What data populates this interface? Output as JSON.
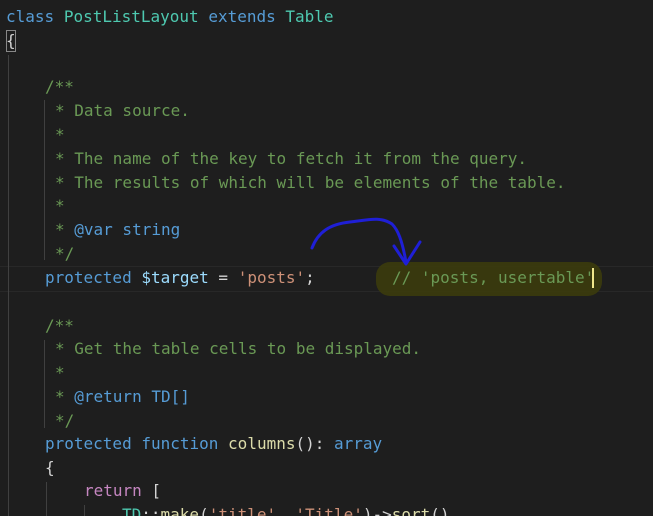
{
  "code": {
    "line1": {
      "kw_class": "class",
      "class_name": "PostListLayout",
      "kw_extends": "extends",
      "parent": "Table"
    },
    "line2": {
      "brace": "{"
    },
    "doc1": {
      "open": "/**",
      "l1": "* Data source.",
      "l2": "*",
      "l3": "* The name of the key to fetch it from the query.",
      "l4": "* The results of which will be elements of the table.",
      "l5": "*",
      "l6_star": "* ",
      "l6_tag": "@var",
      "l6_type": " string",
      "close": "*/"
    },
    "target_line": {
      "kw_protected": "protected",
      "var": "$target",
      "op": " = ",
      "value": "'posts'",
      "semi": ";",
      "comment": "// 'posts, usertable'"
    },
    "doc2": {
      "open": "/**",
      "l1": "* Get the table cells to be displayed.",
      "l2": "*",
      "l3_star": "* ",
      "l3_tag": "@return",
      "l3_type": " TD[]",
      "close": "*/"
    },
    "columns_line": {
      "kw_protected": "protected",
      "kw_function": "function",
      "fn_name": "columns",
      "paren": "(): ",
      "ret_type": "array"
    },
    "brace_open": "{",
    "return_line": {
      "kw_return": "return",
      "bracket": " ["
    },
    "td_line": {
      "cls": "TD",
      "sep": "::",
      "fn": "make",
      "p1": "(",
      "s1": "'title'",
      "comma": ", ",
      "s2": "'Title'",
      "p2": ")->",
      "fn2": "sort",
      "p3": "()"
    }
  },
  "annotation": {
    "ink_color": "#1f1fd6",
    "highlight_color": "#3a3a0e"
  }
}
